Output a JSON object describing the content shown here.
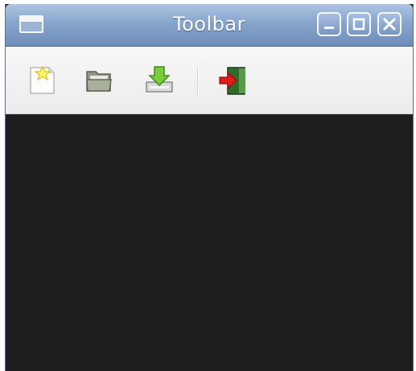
{
  "window": {
    "title": "Toolbar"
  },
  "titlebar": {
    "window_menu_icon": "window-menu-icon",
    "controls": [
      "minimize-icon",
      "maximize-icon",
      "close-icon"
    ]
  },
  "toolbar": {
    "items": [
      {
        "name": "new",
        "icon": "new-document-icon"
      },
      {
        "name": "open",
        "icon": "open-folder-icon"
      },
      {
        "name": "save",
        "icon": "save-download-icon"
      },
      {
        "name": "exit",
        "icon": "exit-door-icon"
      }
    ]
  },
  "colors": {
    "titlebar": "#87a5cc",
    "toolbar": "#f0f0f0",
    "content": "#1e1e1e"
  }
}
